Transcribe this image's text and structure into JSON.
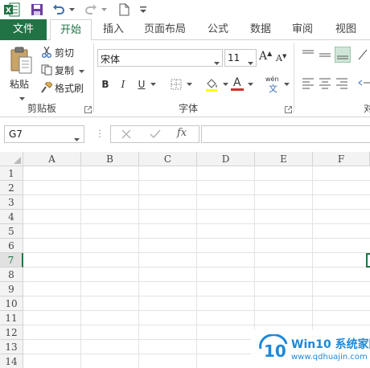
{
  "quick_access": {
    "icons": [
      "excel-logo-icon",
      "save-icon",
      "undo-icon",
      "redo-icon",
      "new-file-icon",
      "customize-dropdown-icon"
    ]
  },
  "tabs": [
    {
      "label": "文件"
    },
    {
      "label": "开始"
    },
    {
      "label": "插入"
    },
    {
      "label": "页面布局"
    },
    {
      "label": "公式"
    },
    {
      "label": "数据"
    },
    {
      "label": "审阅"
    },
    {
      "label": "视图"
    }
  ],
  "ribbon": {
    "clipboard": {
      "paste_label": "粘贴",
      "cut_label": "剪切",
      "copy_label": "复制",
      "format_painter_label": "格式刷",
      "group_label": "剪贴板"
    },
    "font": {
      "font_name": "宋体",
      "font_size": "11",
      "grow_label": "A",
      "shrink_label": "A",
      "bold_label": "B",
      "italic_label": "I",
      "underline_label": "U",
      "font_color_label": "A",
      "phonetic_label": "wén",
      "phonetic_char": "文",
      "group_label": "字体"
    },
    "alignment": {
      "group_label": "对"
    }
  },
  "formula_bar": {
    "name_box": "G7",
    "dots": "⋮",
    "fx_label": "fx",
    "formula": ""
  },
  "sheet": {
    "columns": [
      "A",
      "B",
      "C",
      "D",
      "E",
      "F"
    ],
    "rows": [
      "1",
      "2",
      "3",
      "4",
      "5",
      "6",
      "7",
      "8",
      "9",
      "10",
      "11",
      "12",
      "13",
      "14"
    ],
    "active_row": "7"
  },
  "watermark": {
    "brand": "Win10 系统家园",
    "url": "www.qdhuajin.com"
  },
  "colors": {
    "accent": "#217346",
    "font_color": "#d32f2f",
    "watermark": "#1e88d8"
  }
}
